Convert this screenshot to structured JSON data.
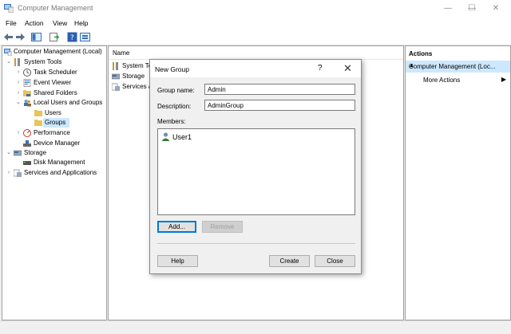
{
  "window": {
    "title": "Computer Management"
  },
  "menu": [
    "File",
    "Action",
    "View",
    "Help"
  ],
  "tree": [
    {
      "label": "Computer Management (Local)",
      "level": 0,
      "exp": ""
    },
    {
      "label": "System Tools",
      "level": 0,
      "exp": "⌄"
    },
    {
      "label": "Task Scheduler",
      "level": 1,
      "exp": "›"
    },
    {
      "label": "Event Viewer",
      "level": 1,
      "exp": "›"
    },
    {
      "label": "Shared Folders",
      "level": 1,
      "exp": "›"
    },
    {
      "label": "Local Users and Groups",
      "level": 1,
      "exp": "⌄"
    },
    {
      "label": "Users",
      "level": 2,
      "exp": ""
    },
    {
      "label": "Groups",
      "level": 2,
      "exp": "",
      "selected": true
    },
    {
      "label": "Performance",
      "level": 1,
      "exp": "›"
    },
    {
      "label": "Device Manager",
      "level": 1,
      "exp": ""
    },
    {
      "label": "Storage",
      "level": 0,
      "exp": "⌄"
    },
    {
      "label": "Disk Management",
      "level": 1,
      "exp": ""
    },
    {
      "label": "Services and Applications",
      "level": 0,
      "exp": "›"
    }
  ],
  "list": {
    "header": "Name",
    "rows": [
      "System To",
      "Storage",
      "Services a"
    ]
  },
  "actions": {
    "header": "Actions",
    "selected": "Computer Management (Loc...",
    "more": "More Actions"
  },
  "dialog": {
    "title": "New Group",
    "help": "?",
    "close": "✕",
    "group_name_label": "Group name:",
    "group_name_value": "Admin",
    "description_label": "Description:",
    "description_value": "AdminGroup",
    "members_label": "Members:",
    "members": [
      "User1"
    ],
    "add": "Add...",
    "remove": "Remove",
    "help_btn": "Help",
    "create": "Create",
    "close_btn": "Close"
  }
}
